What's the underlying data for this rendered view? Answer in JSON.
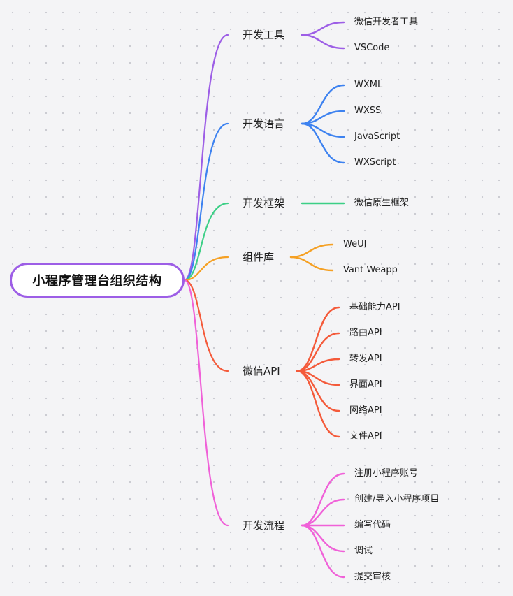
{
  "root": {
    "title": "小程序管理台组织结构",
    "color": "#9d5ee6"
  },
  "branches": [
    {
      "label": "开发工具",
      "color": "#9d5ee6",
      "children": [
        "微信开发者工具",
        "VSCode"
      ]
    },
    {
      "label": "开发语言",
      "color": "#3d82f0",
      "children": [
        "WXML",
        "WXSS",
        "JavaScript",
        "WXScript"
      ]
    },
    {
      "label": "开发框架",
      "color": "#3ccf86",
      "children": [
        "微信原生框架"
      ]
    },
    {
      "label": "组件库",
      "color": "#f5a023",
      "children": [
        "WeUI",
        "Vant Weapp"
      ]
    },
    {
      "label": "微信API",
      "color": "#f45a3a",
      "children": [
        "基础能力API",
        "路由API",
        "转发API",
        "界面API",
        "网络API",
        "文件API"
      ]
    },
    {
      "label": "开发流程",
      "color": "#f061d8",
      "children": [
        "注册小程序账号",
        "创建/导入小程序项目",
        "编写代码",
        "调试",
        "提交审核"
      ]
    }
  ]
}
